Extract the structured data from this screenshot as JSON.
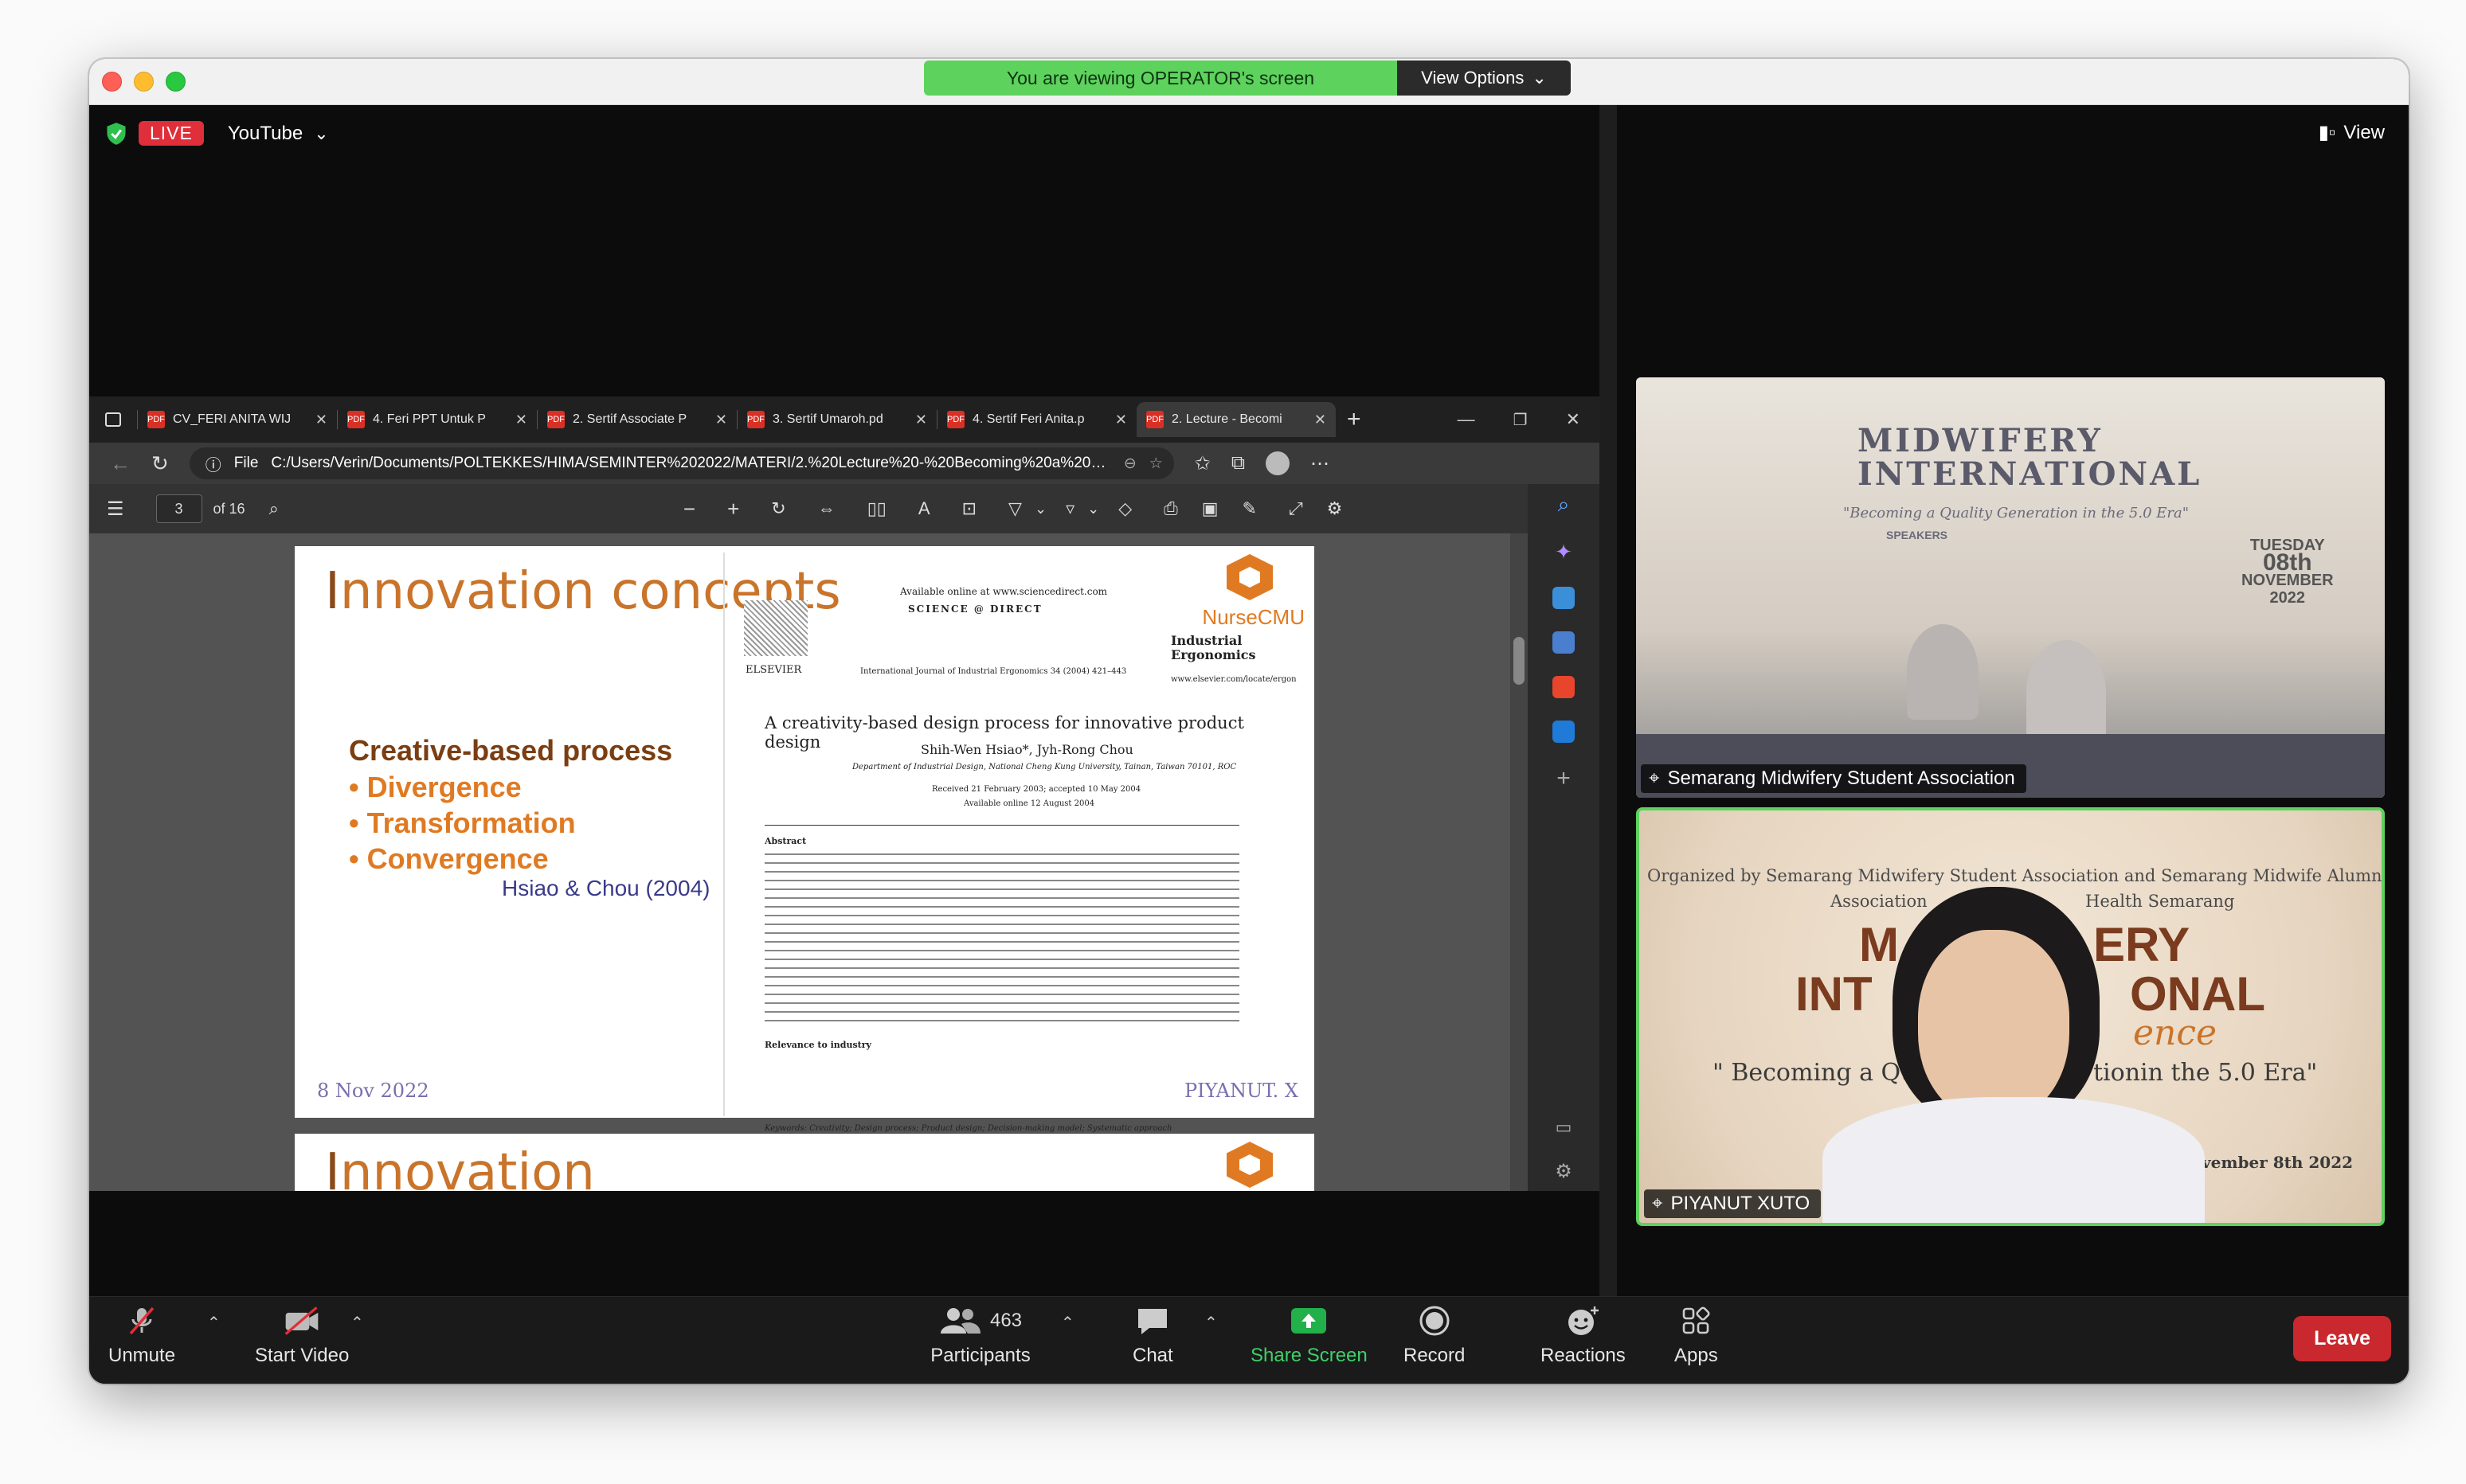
{
  "banner": {
    "text": "You are viewing OPERATOR's screen",
    "options_label": "View Options"
  },
  "top": {
    "live_label": "LIVE",
    "stream_label": "YouTube",
    "view_label": "View"
  },
  "browser": {
    "tabs": [
      {
        "label": "CV_FERI ANITA WIJ"
      },
      {
        "label": "4. Feri PPT Untuk P"
      },
      {
        "label": "2. Sertif Associate P"
      },
      {
        "label": "3. Sertif Umaroh.pd"
      },
      {
        "label": "4. Sertif Feri Anita.p"
      },
      {
        "label": "2. Lecture - Becomi"
      }
    ],
    "file_label": "File",
    "url": "C:/Users/Verin/Documents/POLTEKKES/HIMA/SEMINTER%202022/MATERI/2.%20Lecture%20-%20Becoming%20a%20quality%20ge...",
    "page_current": "3",
    "page_total": "of 16"
  },
  "slide": {
    "title_cap": "I",
    "title_rest": "nnovation concepts",
    "subheading": "Creative-based process",
    "bullets": [
      "• Divergence",
      "• Transformation",
      "• Convergence"
    ],
    "citation": "Hsiao & Chou (2004)",
    "date": "8 Nov 2022",
    "author": "PIYANUT. X",
    "logo_text": "NurseCMU",
    "paper": {
      "available": "Available online at www.sciencedirect.com",
      "sd": "SCIENCE @ DIRECT",
      "elsevier": "ELSEVIER",
      "journal": "Industrial Ergonomics",
      "jref": "International Journal of Industrial Ergonomics 34 (2004) 421–443",
      "url": "www.elsevier.com/locate/ergon",
      "title": "A creativity-based design process for innovative product design",
      "authors": "Shih-Wen Hsiao*, Jyh-Rong Chou",
      "dept": "Department of Industrial Design, National Cheng Kung University, Tainan, Taiwan 70101, ROC",
      "received": "Received 21 February 2003; accepted 10 May 2004",
      "online": "Available online 12 August 2004",
      "abstract_head": "Abstract",
      "relevance_head": "Relevance to industry",
      "keywords": "Keywords: Creativity; Design process; Product design; Decision-making model; Systematic approach"
    },
    "next_title_cap": "I",
    "next_title_rest": "nnovation"
  },
  "tiles": [
    {
      "name": "Semarang Midwifery Student Association",
      "banner_line1": "MIDWIFERY",
      "banner_line2": "INTERNATIONAL",
      "banner_sub": "\"Becoming a Quality Generation in the 5.0 Era\"",
      "speakers": "SPEAKERS",
      "day": "TUESDAY",
      "date_num": "08th",
      "month": "NOVEMBER",
      "year": "2022"
    },
    {
      "name": "PIYANUT XUTO",
      "organized": "Organized by Semarang Midwifery Student Association and Semarang Midwife Alumni",
      "assoc": "Association",
      "health": "Health Semarang",
      "big1": "M",
      "big1b": "ERY",
      "big2": "INT",
      "big2b": "ONAL",
      "script": "ence",
      "quote_a": "\" Becoming a Qu",
      "quote_b": "tionin the 5.0 Era\"",
      "date": "vember 8th 2022"
    }
  ],
  "toolbar": {
    "unmute": "Unmute",
    "start_video": "Start Video",
    "participants": "Participants",
    "participants_count": "463",
    "chat": "Chat",
    "share": "Share Screen",
    "record": "Record",
    "reactions": "Reactions",
    "apps": "Apps",
    "leave": "Leave"
  },
  "colors": {
    "accent_green": "#5dd25d",
    "leave_red": "#c8282e",
    "slide_orange": "#e07a22"
  }
}
